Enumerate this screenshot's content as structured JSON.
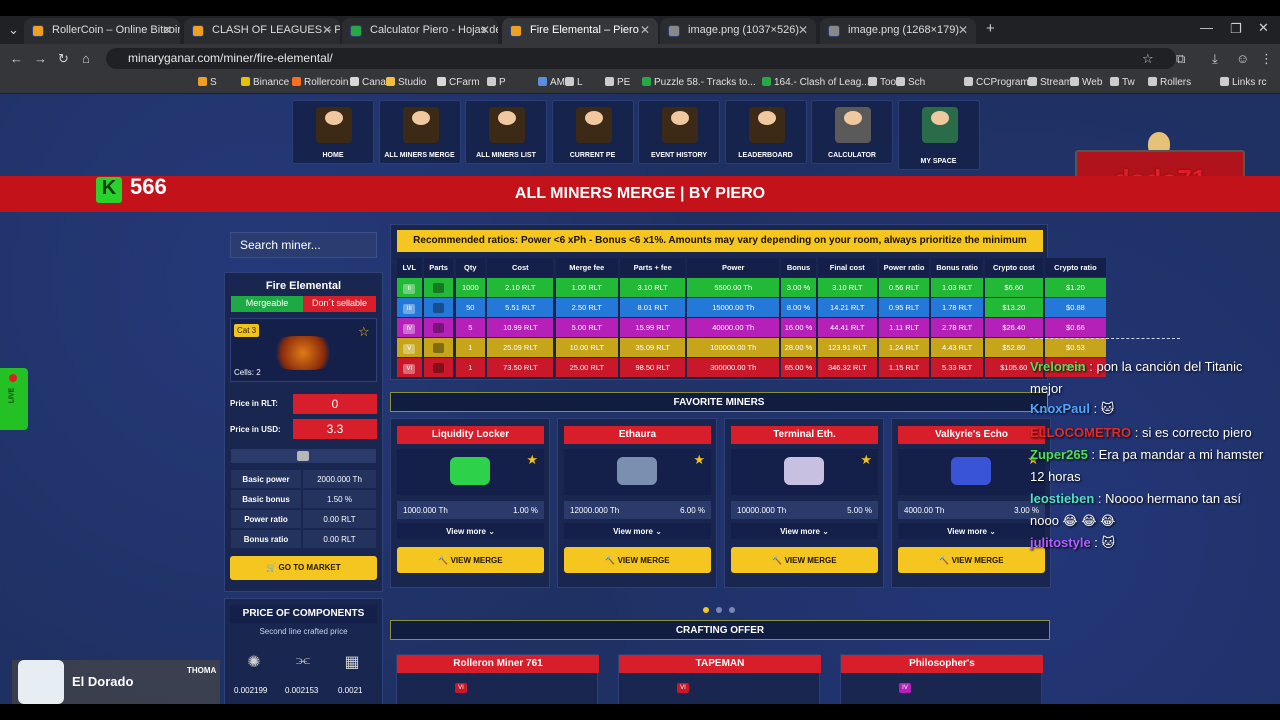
{
  "browser": {
    "tabs": [
      {
        "title": "RollerCoin – Online Bitcoin Min...",
        "fav": "#f0a020"
      },
      {
        "title": "CLASH OF LEAGUES – Piero",
        "fav": "#f0a020"
      },
      {
        "title": "Calculator Piero - Hojas de cálc...",
        "fav": "#27a844"
      },
      {
        "title": "Fire Elemental – Piero",
        "fav": "#f0a020"
      },
      {
        "title": "image.png (1037×526)",
        "fav": "#888888"
      },
      {
        "title": "image.png (1268×179)",
        "fav": "#888888"
      }
    ],
    "url": "minaryganar.com/miner/fire-elemental/",
    "bookmarks": [
      "S",
      "Binance",
      "Rollercoin",
      "Canal",
      "Studio",
      "CFarm",
      "P",
      "AM",
      "L",
      "PE",
      "Puzzle 58.- Tracks to...",
      "164.- Clash of Leag...",
      "Tools",
      "Sch",
      "CCProgram",
      "Stream",
      "Web",
      "Tw",
      "Rollers",
      "Links rc"
    ]
  },
  "nav": {
    "items": [
      "HOME",
      "ALL MINERS MERGE",
      "ALL MINERS LIST",
      "CURRENT PE",
      "EVENT HISTORY",
      "LEADERBOARD",
      "CALCULATOR",
      "MY SPACE"
    ]
  },
  "header": {
    "title": "ALL MINERS MERGE | BY PIERO",
    "k_count": "566",
    "k_letter": "K",
    "streamer_name": "dodo71"
  },
  "live": {
    "label": "LIVE"
  },
  "search": {
    "placeholder": "Search miner..."
  },
  "miner": {
    "name": "Fire Elemental",
    "tag_mergeable": "Mergeable",
    "tag_sellable": "Don´t sellable",
    "category": "Cat 3",
    "cells": "Cells: 2",
    "price_rlt_label": "Price in RLT:",
    "price_rlt": "0",
    "price_usd_label": "Price in USD:",
    "price_usd": "3.3",
    "slider_label": "I",
    "stats": [
      {
        "k": "Basic power",
        "v": "2000.000 Th"
      },
      {
        "k": "Basic bonus",
        "v": "1.50 %"
      },
      {
        "k": "Power ratio",
        "v": "0.00 RLT"
      },
      {
        "k": "Bonus ratio",
        "v": "0.00 RLT"
      }
    ],
    "go_market": "GO TO MARKET"
  },
  "components": {
    "title": "PRICE OF COMPONENTS",
    "subtitle": "Second line crafted price",
    "values": [
      "0.002199",
      "0.002153",
      "0.0021"
    ]
  },
  "ratios": {
    "recommended": "Recommended ratios: Power <6 xPh - Bonus <6 x1%. Amounts may vary depending on your room, always prioritize the minimum",
    "headers": [
      "LVL",
      "Parts",
      "Qty",
      "Cost",
      "Merge fee",
      "Parts + fee",
      "Power",
      "Bonus",
      "Final cost",
      "Power ratio",
      "Bonus ratio",
      "Crypto cost",
      "Crypto ratio"
    ],
    "rows": [
      {
        "lvl": "II",
        "qty": "1000",
        "cost": "2.10 RLT",
        "fee": "1.00 RLT",
        "pf": "3.10 RLT",
        "power": "5500.00 Th",
        "bonus": "3.00 %",
        "final": "3.10 RLT",
        "pr": "0.56 RLT",
        "br": "1.03 RLT",
        "cc": "$6.60",
        "cr": "$1.20",
        "color": "#22b936",
        "ccColor": "#22b936"
      },
      {
        "lvl": "III",
        "qty": "50",
        "cost": "5.51 RLT",
        "fee": "2.50 RLT",
        "pf": "8.01 RLT",
        "power": "15000.00 Th",
        "bonus": "8.00 %",
        "final": "14.21 RLT",
        "pr": "0.95 RLT",
        "br": "1.78 RLT",
        "cc": "$13.20",
        "cr": "$0.88",
        "color": "#2478d8",
        "ccColor": "#22b936"
      },
      {
        "lvl": "IV",
        "qty": "5",
        "cost": "10.99 RLT",
        "fee": "5.00 RLT",
        "pf": "15.99 RLT",
        "power": "40000.00 Th",
        "bonus": "16.00 %",
        "final": "44.41 RLT",
        "pr": "1.11 RLT",
        "br": "2.78 RLT",
        "cc": "$26.40",
        "cr": "$0.66",
        "color": "#b521b8",
        "ccColor": "#b521b8"
      },
      {
        "lvl": "V",
        "qty": "1",
        "cost": "25.09 RLT",
        "fee": "10.00 RLT",
        "pf": "35.09 RLT",
        "power": "100000.00 Th",
        "bonus": "28.00 %",
        "final": "123.91 RLT",
        "pr": "1.24 RLT",
        "br": "4.43 RLT",
        "cc": "$52.80",
        "cr": "$0.53",
        "color": "#c7a51b",
        "ccColor": "#c7a51b"
      },
      {
        "lvl": "VI",
        "qty": "1",
        "cost": "73.50 RLT",
        "fee": "25.00 RLT",
        "pf": "98.50 RLT",
        "power": "300000.00 Th",
        "bonus": "65.00 %",
        "final": "346.32 RLT",
        "pr": "1.15 RLT",
        "br": "5.33 RLT",
        "cc": "$105.60",
        "cr": "$0.35",
        "color": "#c9182a",
        "ccColor": "#c9182a"
      }
    ]
  },
  "favorites": {
    "title": "FAVORITE MINERS",
    "items": [
      {
        "name": "Liquidity Locker",
        "power": "1000.000 Th",
        "bonus": "1.00 %",
        "pic": "#2ed14a"
      },
      {
        "name": "Ethaura",
        "power": "12000.000 Th",
        "bonus": "6.00 %",
        "pic": "#7b8fb0"
      },
      {
        "name": "Terminal Eth.",
        "power": "10000.000 Th",
        "bonus": "5.00 %",
        "pic": "#c7c0e0"
      },
      {
        "name": "Valkyrie's Echo",
        "power": "4000.00 Th",
        "bonus": "3.00 %",
        "pic": "#3a54d8"
      }
    ],
    "view_more": "View more",
    "view_merge": "VIEW MERGE"
  },
  "crafting": {
    "title": "CRAFTING OFFER",
    "items": [
      {
        "name": "Rolleron Miner 761",
        "lvl": "VI",
        "lvlColor": "#c9182a"
      },
      {
        "name": "TAPEMAN",
        "lvl": "VI",
        "lvlColor": "#c9182a"
      },
      {
        "name": "Philosopher's",
        "lvl": "IV",
        "lvlColor": "#b521b8"
      }
    ]
  },
  "chat": [
    {
      "user": "Vrelorein",
      "userColor": "#4fe04f",
      "msg": " : pon la canción del Titanic mejor"
    },
    {
      "user": "KnoxPaul",
      "userColor": "#4fa6ff",
      "msg": " : 🐱"
    },
    {
      "user": "ELLOCOMETRO",
      "userColor": "#e22a2a",
      "msg": " : si es correcto piero"
    },
    {
      "user": "Zuper265",
      "userColor": "#4fe04f",
      "msg": " : Era pa mandar a mi hamster 12 horas"
    },
    {
      "user": "leostieben",
      "userColor": "#4fe0c8",
      "msg": " : Noooo hermano tan así nooo 😂 😂 😂"
    },
    {
      "user": "julitostyle",
      "userColor": "#b45cff",
      "msg": " : 🐱"
    }
  ],
  "overlay": {
    "name": "El Dorado",
    "small": "THOMA"
  }
}
